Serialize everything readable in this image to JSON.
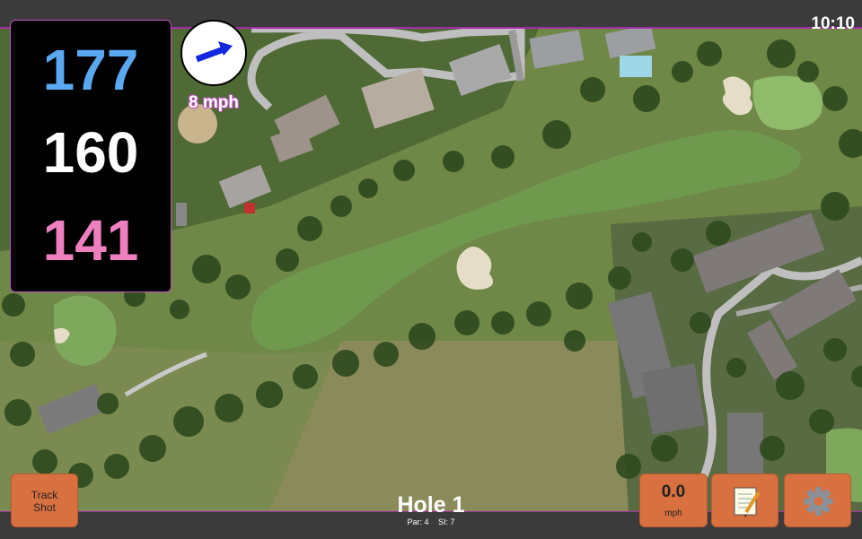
{
  "status": {
    "time": "10:10"
  },
  "distances": {
    "back": "177",
    "center": "160",
    "front": "141"
  },
  "wind": {
    "speed_label": "8 mph"
  },
  "hole": {
    "title": "Hole 1",
    "par": "Par: 4",
    "si": "SI: 7"
  },
  "buttons": {
    "track_line1": "Track",
    "track_line2": "Shot",
    "speed_value": "0.0",
    "speed_unit": "mph",
    "notes_icon": "notepad-icon",
    "settings_icon": "gear-icon"
  },
  "colors": {
    "back": "#5aa8f0",
    "center": "#ffffff",
    "front": "#ef80c0",
    "accent": "#a32aa8",
    "button": "#d9703f"
  }
}
